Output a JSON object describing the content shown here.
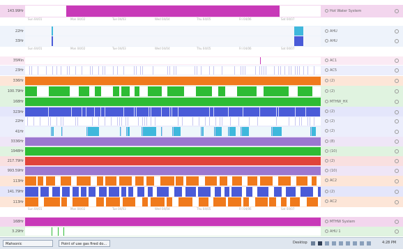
{
  "sections": [
    {
      "label": "143.99Hr",
      "name": "Hot Water System",
      "tone": "#f3d6ee"
    },
    {
      "label": "22Hr",
      "name": "AHU",
      "tone": "#eef3fb"
    },
    {
      "label": "33Hr",
      "name": "AHU",
      "tone": "#eef3fb"
    },
    {
      "label": "35Min",
      "name": "AC1",
      "tone": "#fbeaf4"
    },
    {
      "label": "23Hr",
      "name": "AC5",
      "tone": "#eceefc"
    },
    {
      "label": "336Hr",
      "name": "(2)",
      "tone": "#fde6d8"
    },
    {
      "label": "100.79Hr",
      "name": "(2)",
      "tone": "#e0f3e0"
    },
    {
      "label": "168Hr",
      "name": "MTHW_HX",
      "tone": "#e0f3e0"
    },
    {
      "label": "323Hr",
      "name": "(2)",
      "tone": "#e4e6fb"
    },
    {
      "label": "22Hr",
      "name": "(2)",
      "tone": "#eceefc"
    },
    {
      "label": "41Hr",
      "name": "(2)",
      "tone": "#eceefc"
    },
    {
      "label": "3336Hr",
      "name": "(8)",
      "tone": "#efe6f7"
    },
    {
      "label": "1948Hr",
      "name": "(10)",
      "tone": "#e0f3e0"
    },
    {
      "label": "217.79Hr",
      "name": "(2)",
      "tone": "#f9e0e0"
    },
    {
      "label": "993.59Hr",
      "name": "(10)",
      "tone": "#efe6f7"
    },
    {
      "label": "113Hr",
      "name": "AC2",
      "tone": "#fde6d8"
    },
    {
      "label": "141.79Hr",
      "name": "(2)",
      "tone": "#e4e6fb"
    },
    {
      "label": "113Hr",
      "name": "AC2",
      "tone": "#fde6d8"
    },
    {
      "label": "168Hr",
      "name": "MTHW System",
      "tone": "#f3d6ee"
    },
    {
      "label": "3.29Hr",
      "name": "AHU 1",
      "tone": "#e0f3e0"
    }
  ],
  "axis_ticks": [
    "Sun 04/01",
    "Mon 04/02",
    "Tue 04/03",
    "Wed 04/04",
    "Thu 04/05",
    "Fri 04/06",
    "Sat 04/07"
  ],
  "colors": {
    "magenta": "#c839b8",
    "blue": "#4a5bd8",
    "teal": "#3fb8dc",
    "orange": "#f07a1c",
    "green": "#2ebc34",
    "purple": "#9b78d0",
    "red": "#e0443a",
    "lavender": "#c7c6f2"
  },
  "taskbar": {
    "start_label": "Mahsonic",
    "window_label": "Point of use gas fired do...",
    "tray_text": "Desktop",
    "clock": "4:28 PM"
  }
}
